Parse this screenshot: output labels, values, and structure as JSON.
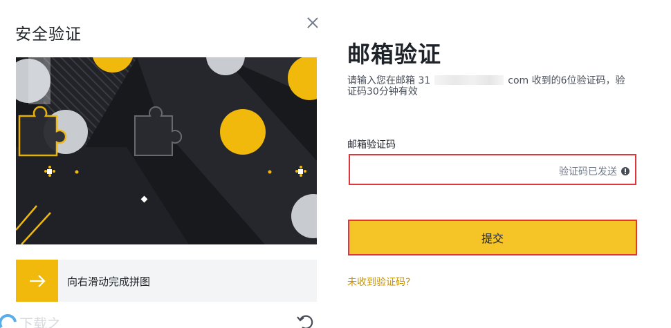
{
  "modal": {
    "title": "安全验证",
    "slider_label": "向右滑动完成拼图",
    "icons": [
      "close-icon",
      "arrow-right-icon",
      "refresh-icon"
    ]
  },
  "form": {
    "title": "邮箱验证",
    "desc_prefix": "请输入您在邮箱 31",
    "desc_suffix": "com 收到的6位验证码，验证码30分钟有效",
    "field_label": "邮箱验证码",
    "input_value": "",
    "code_sent_text": "验证码已发送",
    "submit_label": "提交",
    "resend_link": "未收到验证码?"
  },
  "colors": {
    "accent": "#f0b90b",
    "button": "#f5c527",
    "highlight_border": "#e0353b",
    "link": "#c99400"
  }
}
